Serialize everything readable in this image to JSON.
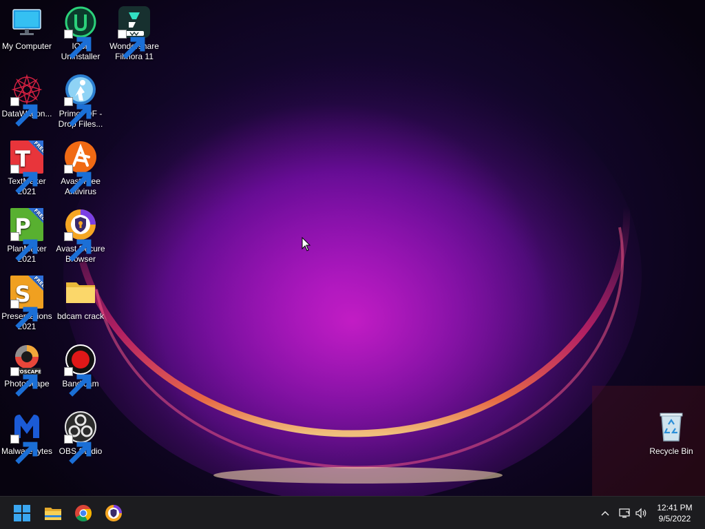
{
  "desktop": {
    "icons": [
      {
        "id": "my-computer",
        "label": "My Computer",
        "shortcut": false,
        "icon": "monitor-icon"
      },
      {
        "id": "iobit-uninstaller",
        "label": "IObit Uninstaller",
        "shortcut": true,
        "icon": "iobit-uninstaller-icon"
      },
      {
        "id": "wondershare-filmora",
        "label": "Wondershare Filmora 11",
        "shortcut": true,
        "icon": "filmora-icon"
      },
      {
        "id": "datawagon",
        "label": "DataWagon...",
        "shortcut": true,
        "icon": "datawagon-icon"
      },
      {
        "id": "primopdf",
        "label": "PrimoPDF - Drop Files...",
        "shortcut": true,
        "icon": "primopdf-icon"
      },
      {
        "id": "textmaker",
        "label": "TextMaker 2021",
        "shortcut": true,
        "icon": "textmaker-icon",
        "badge": "FREE",
        "letter": "T"
      },
      {
        "id": "avast-antivirus",
        "label": "Avast Free Antivirus",
        "shortcut": true,
        "icon": "avast-antivirus-icon"
      },
      {
        "id": "planmaker",
        "label": "PlanMaker 2021",
        "shortcut": true,
        "icon": "planmaker-icon",
        "badge": "FREE",
        "letter": "P"
      },
      {
        "id": "avast-browser",
        "label": "Avast Secure Browser",
        "shortcut": true,
        "icon": "avast-browser-icon"
      },
      {
        "id": "presentations",
        "label": "Presentations 2021",
        "shortcut": true,
        "icon": "presentations-icon",
        "badge": "FREE",
        "letter": "S"
      },
      {
        "id": "bdcam-crack",
        "label": "bdcam crack",
        "shortcut": false,
        "icon": "folder-icon"
      },
      {
        "id": "photoscape",
        "label": "PhotoScape",
        "shortcut": true,
        "icon": "photoscape-icon",
        "caption": "OTOSCAPE"
      },
      {
        "id": "bandicam",
        "label": "Bandicam",
        "shortcut": true,
        "icon": "bandicam-icon"
      },
      {
        "id": "malwarebytes",
        "label": "Malwarebytes",
        "shortcut": true,
        "icon": "malwarebytes-icon"
      },
      {
        "id": "obs-studio",
        "label": "OBS Studio",
        "shortcut": true,
        "icon": "obs-icon"
      },
      {
        "id": "recycle-bin",
        "label": "Recycle Bin",
        "shortcut": false,
        "icon": "recycle-bin-icon"
      }
    ]
  },
  "taskbar": {
    "pinned": [
      {
        "id": "start",
        "icon": "windows-start-icon"
      },
      {
        "id": "file-explorer",
        "icon": "file-explorer-icon"
      },
      {
        "id": "chrome",
        "icon": "chrome-icon"
      },
      {
        "id": "avast-browser",
        "icon": "avast-browser-icon"
      }
    ],
    "tray": [
      {
        "id": "show-hidden",
        "icon": "chevron-up-icon"
      },
      {
        "id": "network",
        "icon": "network-icon"
      },
      {
        "id": "volume",
        "icon": "volume-icon"
      }
    ],
    "clock": {
      "time": "12:41 PM",
      "date": "9/5/2022"
    }
  },
  "colors": {
    "taskbar_bg": "#1c1c1f",
    "windows_blue": "#3aa6f0",
    "wallpaper_magenta": "#c018c8",
    "wallpaper_arc_orange": "#ff7a3c"
  }
}
